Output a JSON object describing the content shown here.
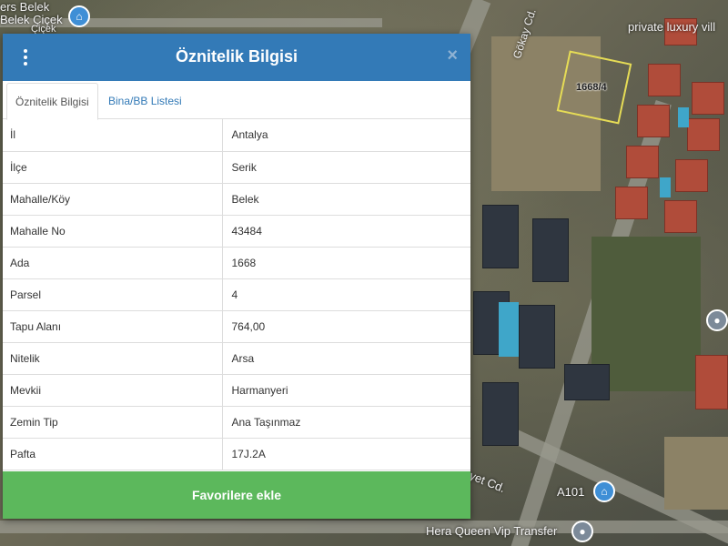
{
  "map": {
    "parcel_label": "1668/4",
    "labels": {
      "top_left_1": "ers Belek",
      "top_left_2": "Belek Çiçek",
      "top_left_3": "Çiçek",
      "street_gokay": "Gökay Cd.",
      "private_villa": "private luxury vill",
      "street_bottom": "yet Cd.",
      "a101": "A101",
      "hera": "Hera Queen Vip Transfer"
    }
  },
  "panel": {
    "title": "Öznitelik Bilgisi",
    "close_symbol": "×",
    "tabs": [
      {
        "label": "Öznitelik Bilgisi",
        "active": true
      },
      {
        "label": "Bina/BB Listesi",
        "active": false
      }
    ],
    "rows": [
      {
        "key": "İl",
        "value": "Antalya"
      },
      {
        "key": "İlçe",
        "value": "Serik"
      },
      {
        "key": "Mahalle/Köy",
        "value": "Belek"
      },
      {
        "key": "Mahalle No",
        "value": "43484"
      },
      {
        "key": "Ada",
        "value": "1668"
      },
      {
        "key": "Parsel",
        "value": "4"
      },
      {
        "key": "Tapu Alanı",
        "value": "764,00"
      },
      {
        "key": "Nitelik",
        "value": "Arsa"
      },
      {
        "key": "Mevkii",
        "value": "Harmanyeri"
      },
      {
        "key": "Zemin Tip",
        "value": "Ana Taşınmaz"
      },
      {
        "key": "Pafta",
        "value": "17J.2A"
      }
    ],
    "favorite_button": "Favorilere ekle"
  },
  "colors": {
    "header": "#337ab7",
    "favorite_button": "#5cb85c",
    "parcel_outline": "#e6dc56"
  }
}
